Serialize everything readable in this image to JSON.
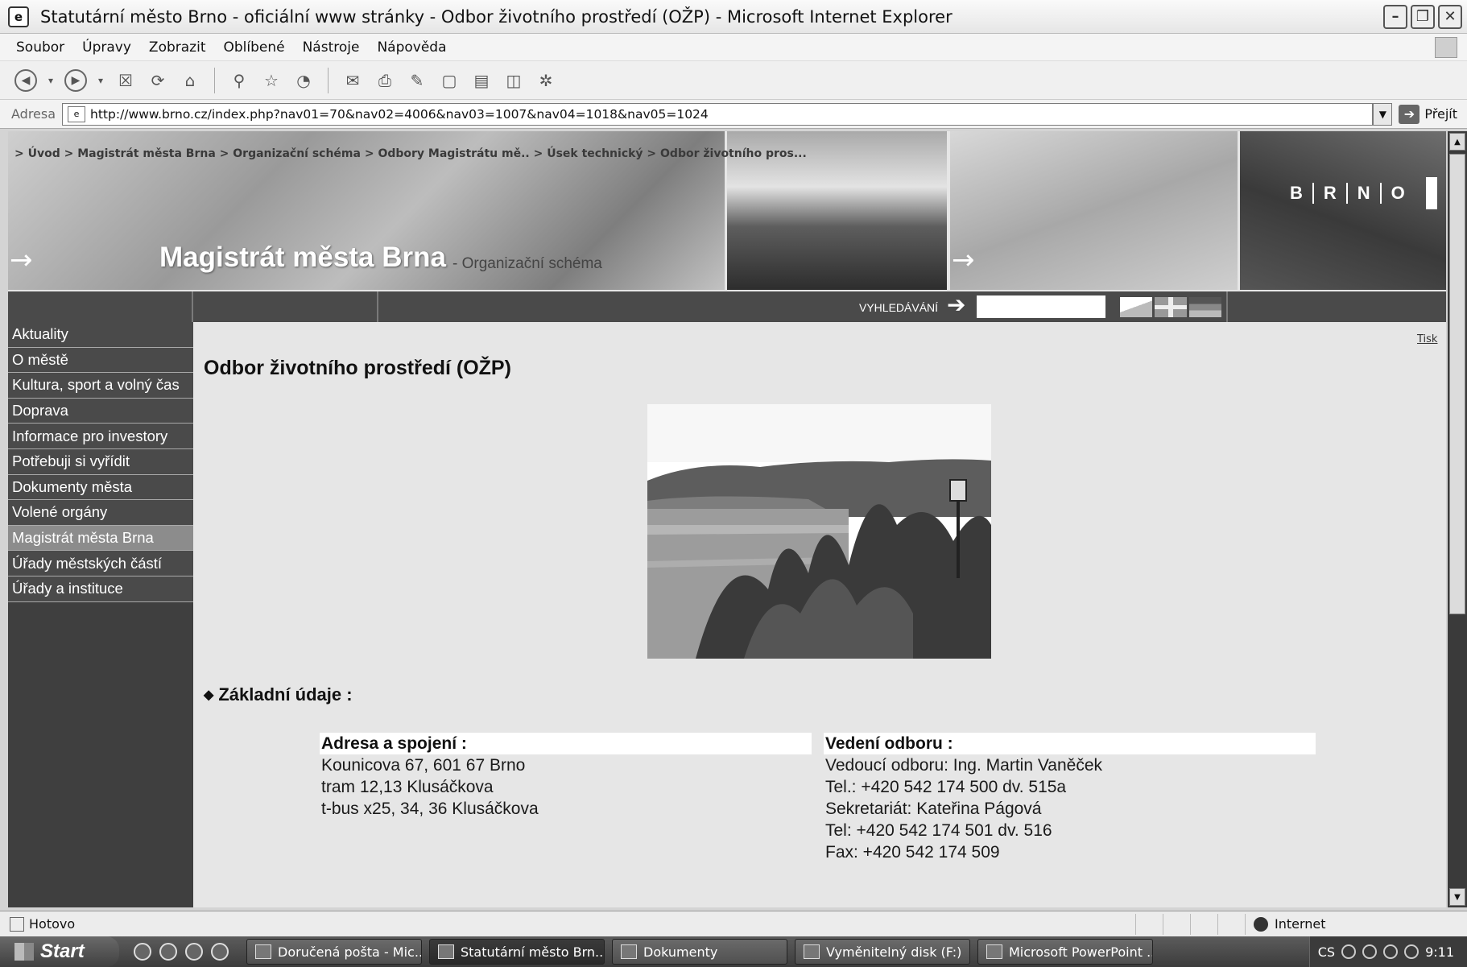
{
  "window": {
    "title": "Statutární město Brno - oficiální www stránky - Odbor životního prostředí (OŽP) - Microsoft Internet Explorer",
    "app_icon": "ie-page-icon",
    "buttons": [
      "minimize-icon",
      "restore-icon",
      "close-icon"
    ]
  },
  "menubar": {
    "items": [
      "Soubor",
      "Úpravy",
      "Zobrazit",
      "Oblíbené",
      "Nástroje",
      "Nápověda"
    ]
  },
  "toolbar": {
    "icons": [
      "back-icon",
      "forward-icon",
      "stop-icon",
      "refresh-icon",
      "home-icon",
      "search-icon",
      "favorites-icon",
      "history-icon",
      "mail-icon",
      "print-icon",
      "edit-icon",
      "discuss-icon",
      "research-icon",
      "messenger-icon",
      "misc-icon"
    ]
  },
  "address": {
    "label": "Adresa",
    "url": "http://www.brno.cz/index.php?nav01=70&nav02=4006&nav03=1007&nav04=1018&nav05=1024",
    "go_label": "Přejít"
  },
  "banner": {
    "breadcrumb": "> Úvod > Magistrát města Brna > Organizační schéma > Odbory Magistrátu mě.. > Úsek technický > Odbor životního pros...",
    "site_title": "Magistrát města Brna",
    "subtitle": "- Organizační schéma",
    "logo_letters": [
      "B",
      "R",
      "N",
      "O"
    ]
  },
  "search": {
    "label": "VYHLEDÁVÁNÍ",
    "value": "",
    "flags": [
      "czech-flag-icon",
      "uk-flag-icon",
      "german-flag-icon"
    ]
  },
  "sidebar": {
    "items": [
      {
        "label": "Aktuality",
        "active": false
      },
      {
        "label": "O městě",
        "active": false
      },
      {
        "label": "Kultura, sport a volný čas",
        "active": false
      },
      {
        "label": "Doprava",
        "active": false
      },
      {
        "label": "Informace pro investory",
        "active": false
      },
      {
        "label": "Potřebuji si vyřídit",
        "active": false
      },
      {
        "label": "Dokumenty města",
        "active": false
      },
      {
        "label": "Volené orgány",
        "active": false
      },
      {
        "label": "Magistrát města Brna",
        "active": true
      },
      {
        "label": "Úřady městských částí",
        "active": false
      },
      {
        "label": "Úřady a instituce",
        "active": false
      }
    ]
  },
  "main": {
    "print_link": "Tisk",
    "title": "Odbor životního prostředí (OŽP)",
    "section_title": "Základní údaje :",
    "address": {
      "heading": "Adresa a spojení :",
      "lines": [
        "Kounicova 67, 601 67 Brno",
        "tram 12,13 Klusáčkova",
        "t-bus x25, 34, 36 Klusáčkova"
      ]
    },
    "management": {
      "heading": "Vedení odboru :",
      "lines": [
        "Vedoucí odboru: Ing. Martin Vaněček",
        "Tel.: +420 542 174 500 dv. 515a",
        "Sekretariát: Kateřina Págová",
        "Tel: +420 542 174 501 dv. 516",
        "Fax: +420 542 174 509"
      ]
    }
  },
  "status": {
    "text": "Hotovo",
    "zone": "Internet"
  },
  "taskbar": {
    "start_label": "Start",
    "tasks": [
      {
        "label": "Doručená pošta - Mic...",
        "active": false
      },
      {
        "label": "Statutární město Brn...",
        "active": true
      },
      {
        "label": "Dokumenty",
        "active": false
      },
      {
        "label": "Vyměnitelný disk (F:)",
        "active": false
      },
      {
        "label": "Microsoft PowerPoint ...",
        "active": false
      }
    ],
    "language": "CS",
    "clock": "9:11"
  }
}
